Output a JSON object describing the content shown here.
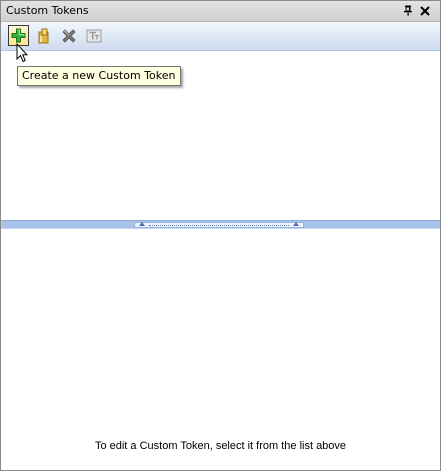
{
  "window": {
    "title": "Custom Tokens"
  },
  "title_buttons": {
    "pin_icon": "pin-icon",
    "close_icon": "close-icon"
  },
  "toolbar": {
    "buttons": [
      {
        "icon": "add-icon",
        "hovered": true
      },
      {
        "icon": "edit-icon",
        "hovered": false
      },
      {
        "icon": "delete-icon",
        "hovered": false
      },
      {
        "icon": "token-icon",
        "hovered": false
      }
    ]
  },
  "tooltip": {
    "text": "Create a new Custom Token"
  },
  "details": {
    "hint": "To edit a Custom Token, select it from the list above"
  },
  "colors": {
    "accent": "#a8c3e9",
    "add_green": "#2fa82f"
  }
}
